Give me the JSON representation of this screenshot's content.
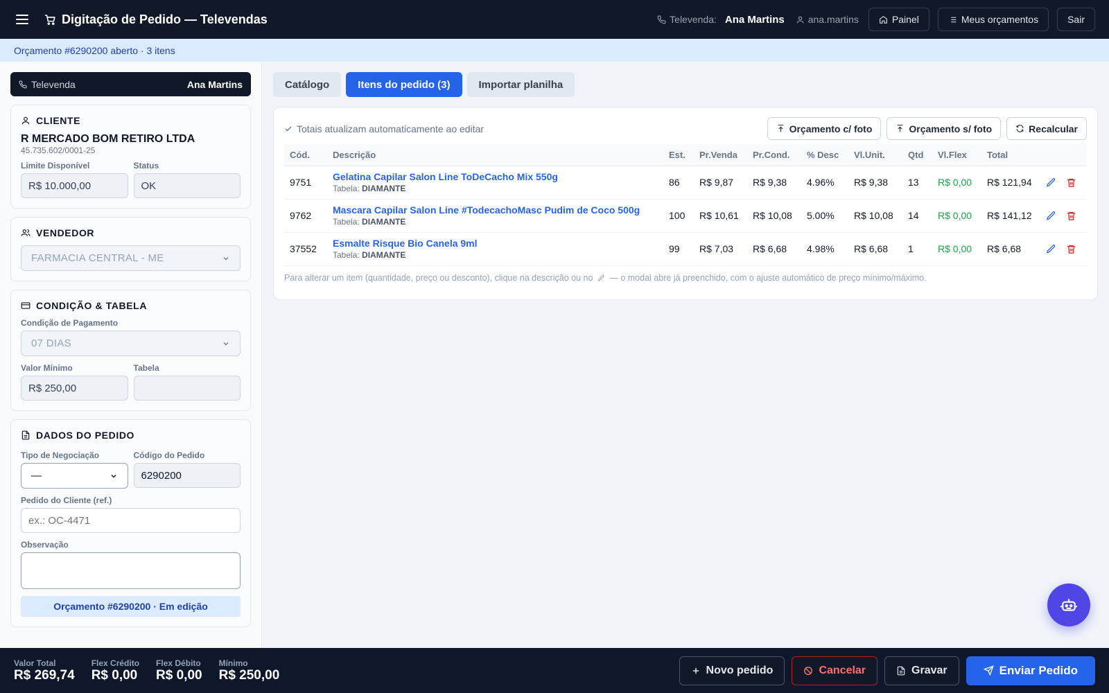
{
  "colors": {
    "topbar": "#111827",
    "accent": "#2563eb",
    "success": "#16a34a",
    "danger": "#dc2626",
    "fab": "#4f46e5"
  },
  "topbar": {
    "title": "Digitação de Pedido — Televendas",
    "televenda_label": "Televenda:",
    "televenda_name": "Ana Martins",
    "user_login": "ana.martins",
    "buttons": {
      "painel": "Painel",
      "orcamentos": "Meus orçamentos",
      "sair": "Sair"
    }
  },
  "infobar": {
    "text": "Orçamento #6290200 aberto · 3 itens"
  },
  "sidebar": {
    "televenda": {
      "label": "Televenda",
      "name": "Ana Martins"
    },
    "cliente": {
      "title": "CLIENTE",
      "name": "R MERCADO BOM RETIRO LTDA",
      "doc": "45.735.602/0001-25",
      "limite_label": "Limite Disponível",
      "limite_value": "R$ 10.000,00",
      "status_label": "Status",
      "status_value": "OK"
    },
    "vendedor": {
      "title": "VENDEDOR",
      "selected": "FARMACIA CENTRAL - ME"
    },
    "condicao": {
      "title": "CONDIÇÃO & TABELA",
      "pagamento_label": "Condição de Pagamento",
      "pagamento_value": "07 DIAS",
      "minimo_label": "Valor Mínimo",
      "minimo_value": "R$ 250,00",
      "tabela_label": "Tabela",
      "tabela_value": ""
    },
    "dados": {
      "title": "DADOS DO PEDIDO",
      "tipo_label": "Tipo de Negociação",
      "tipo_value": "—",
      "codigo_label": "Código do Pedido",
      "codigo_value": "6290200",
      "ref_label": "Pedido do Cliente (ref.)",
      "ref_placeholder": "ex.: OC-4471",
      "obs_label": "Observação",
      "banner": "Orçamento #6290200 · Em edição"
    }
  },
  "main": {
    "tabs": [
      {
        "label": "Catálogo"
      },
      {
        "label": "Itens do pedido (3)"
      },
      {
        "label": "Importar planilha"
      }
    ],
    "auto_note": "Totais atualizam automaticamente ao editar",
    "actions": {
      "com_foto": "Orçamento c/ foto",
      "sem_foto": "Orçamento s/ foto",
      "recalcular": "Recalcular"
    },
    "table": {
      "headers": [
        "Cód.",
        "Descrição",
        "Est.",
        "Pr.Venda",
        "Pr.Cond.",
        "% Desc",
        "Vl.Unit.",
        "Qtd",
        "Vl.Flex",
        "Total"
      ],
      "tabela_prefix": "Tabela:",
      "rows": [
        {
          "cod": "9751",
          "desc": "Gelatina Capilar Salon Line ToDeCacho Mix 550g",
          "tabela": "DIAMANTE",
          "est": "86",
          "pr_venda": "R$ 9,87",
          "pr_cond": "R$ 9,38",
          "desc_pct": "4.96%",
          "vl_unit": "R$ 9,38",
          "qtd": "13",
          "vl_flex": "R$ 0,00",
          "total": "R$ 121,94"
        },
        {
          "cod": "9762",
          "desc": "Mascara Capilar Salon Line #TodecachoMasc Pudim de Coco 500g",
          "tabela": "DIAMANTE",
          "est": "100",
          "pr_venda": "R$ 10,61",
          "pr_cond": "R$ 10,08",
          "desc_pct": "5.00%",
          "vl_unit": "R$ 10,08",
          "qtd": "14",
          "vl_flex": "R$ 0,00",
          "total": "R$ 141,12"
        },
        {
          "cod": "37552",
          "desc": "Esmalte Risque Bio Canela 9ml",
          "tabela": "DIAMANTE",
          "est": "99",
          "pr_venda": "R$ 7,03",
          "pr_cond": "R$ 6,68",
          "desc_pct": "4.98%",
          "vl_unit": "R$ 6,68",
          "qtd": "1",
          "vl_flex": "R$ 0,00",
          "total": "R$ 6,68"
        }
      ]
    },
    "hint_before": "Para alterar um item (quantidade, preço ou desconto), clique na descrição ou no",
    "hint_after": "— o modal abre já preenchido, com o ajuste automático de preço mínimo/máximo."
  },
  "footer": {
    "stats": [
      {
        "label": "Valor Total",
        "value": "R$ 269,74"
      },
      {
        "label": "Flex Crédito",
        "value": "R$ 0,00"
      },
      {
        "label": "Flex Débito",
        "value": "R$ 0,00"
      },
      {
        "label": "Mínimo",
        "value": "R$ 250,00"
      }
    ],
    "buttons": {
      "novo": "Novo pedido",
      "cancelar": "Cancelar",
      "gravar": "Gravar",
      "enviar": "Enviar Pedido"
    }
  }
}
